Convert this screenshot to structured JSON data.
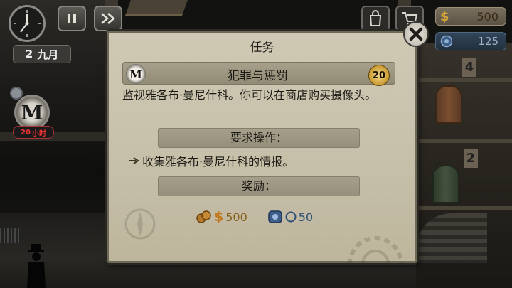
{
  "hud": {
    "date_day": "2",
    "date_month": "九月",
    "money_symbol": "$",
    "money": "500",
    "reputation": "125",
    "shop_icon": "bag-icon",
    "cart_icon": "cart-icon"
  },
  "side_task": {
    "badge_letter": "M",
    "hours": "20",
    "hours_unit": "小时"
  },
  "room_numbers": [
    "4",
    "2"
  ],
  "dialog": {
    "title": "任务",
    "mission_name": "犯罪与惩罚",
    "mission_letter": "M",
    "mission_level": "20",
    "description": "监视雅各布·曼尼什科。你可以在商店购买摄像头。",
    "requirements_header": "要求操作：",
    "requirement_item": "收集雅各布·曼尼什科的情报。",
    "rewards_header": "奖励：",
    "reward_money_symbol": "$",
    "reward_money": "500",
    "reward_reputation": "50"
  },
  "colors": {
    "panel_bg": "#c9c2ab",
    "money_gold": "#d6a437",
    "reputation_blue": "#2f4f7a",
    "danger_red": "#e33333"
  }
}
